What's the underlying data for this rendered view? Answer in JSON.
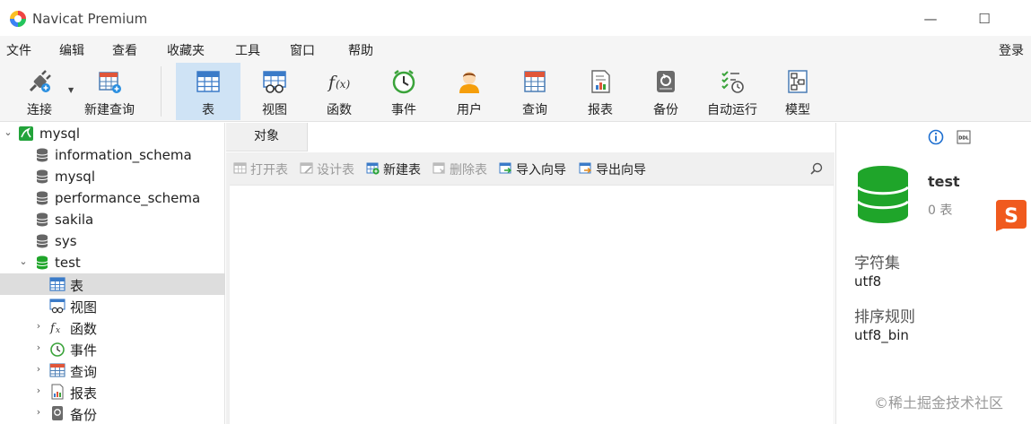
{
  "window": {
    "title": "Navicat Premium",
    "minimize": "—",
    "maximize": "☐"
  },
  "menu": [
    "文件",
    "编辑",
    "查看",
    "收藏夹",
    "工具",
    "窗口",
    "帮助"
  ],
  "login": "登录",
  "toolbar": {
    "connect": "连接",
    "new_query": "新建查询",
    "items": [
      "表",
      "视图",
      "函数",
      "事件",
      "用户",
      "查询",
      "报表",
      "备份",
      "自动运行",
      "模型"
    ]
  },
  "tree": {
    "root": "mysql",
    "databases": [
      "information_schema",
      "mysql",
      "performance_schema",
      "sakila",
      "sys",
      "test"
    ],
    "test_children": [
      "表",
      "视图",
      "函数",
      "事件",
      "查询",
      "报表",
      "备份"
    ]
  },
  "tabs": {
    "objects": "对象"
  },
  "object_toolbar": [
    "打开表",
    "设计表",
    "新建表",
    "删除表",
    "导入向导",
    "导出向导"
  ],
  "info": {
    "name": "test",
    "table_count": "0 表",
    "charset_label": "字符集",
    "charset_value": "utf8",
    "collation_label": "排序规则",
    "collation_value": "utf8_bin",
    "ddl_icon_text": "DDL"
  },
  "watermark": "©稀土掘金技术社区",
  "colors": {
    "accent_green": "#1fa52a",
    "selected_tool": "#cfe3f5",
    "sogou_orange": "#f05a1e"
  }
}
